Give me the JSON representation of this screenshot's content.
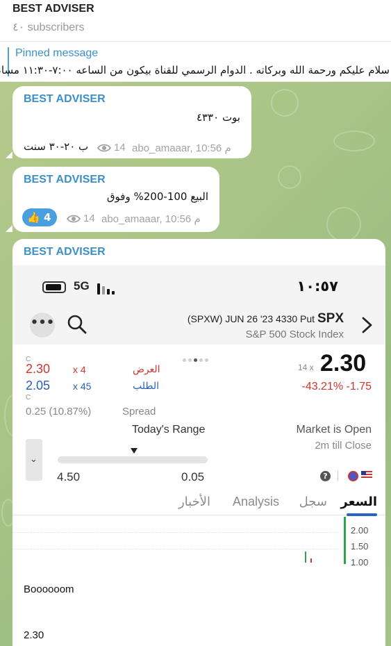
{
  "channel": {
    "title": "BEST ADVISER",
    "subscribers": "٤٠ subscribers"
  },
  "pinned": {
    "label": "Pinned message",
    "text": "سلام عليكم ورحمة الله وبركاته .   الدوام الرسمي للقناة بيكون من الساعه ٧:٠٠-١١:٣٠ مساء"
  },
  "messages": [
    {
      "sender": "BEST ADVISER",
      "line1": "بوت ٤٣٣٠",
      "line2": "ب ٢٠-٣٠ سنت",
      "views": "14",
      "author_time": "abo_amaaar, 10:56 م"
    },
    {
      "sender": "BEST ADVISER",
      "line1": "البيع 100-200% وفوق",
      "reaction": {
        "emoji": "thumbs-up-icon",
        "count": "4"
      },
      "views": "14",
      "author_time": "abo_amaaar, 10:56 م"
    }
  ],
  "screenshot_post": {
    "sender": "BEST ADVISER",
    "status": {
      "network": "5G",
      "time": "١٠:٥٧"
    },
    "contract": {
      "desc": "(SPXW) JUN 26 '23 4330 Put",
      "symbol": "SPX",
      "index": "S&P 500 Stock Index"
    },
    "quote": {
      "ask_label": "العرض",
      "bid_label": "الطلب",
      "c1": "C",
      "ask": "2.30",
      "ask_size": "x 4",
      "bid": "2.05",
      "bid_size": "x 45",
      "c2": "C",
      "spread_value": "0.25 (10.87%)",
      "spread_label": "Spread",
      "last": "2.30",
      "last_size": "14 x",
      "change": "-43.21% -1.75",
      "range_label": "Today's Range",
      "range_low": "4.50",
      "range_high": "0.05",
      "market_status": "Market is Open",
      "close_info": "2m till Close"
    },
    "tabs": [
      {
        "label": "السعر",
        "active": true
      },
      {
        "label": "سجل",
        "active": false
      },
      {
        "label": "Analysis",
        "active": false
      },
      {
        "label": "الأخبار",
        "active": false
      }
    ],
    "chart_ticks": [
      "2.00",
      "1.50",
      "1.00"
    ],
    "caption1": "Boooooom",
    "caption2": "2.30"
  },
  "colors": {
    "accent": "#3c8fc8",
    "ask_red": "#d0342c",
    "bid_blue": "#2a5fb8",
    "tab_underline": "#2a62c7"
  }
}
